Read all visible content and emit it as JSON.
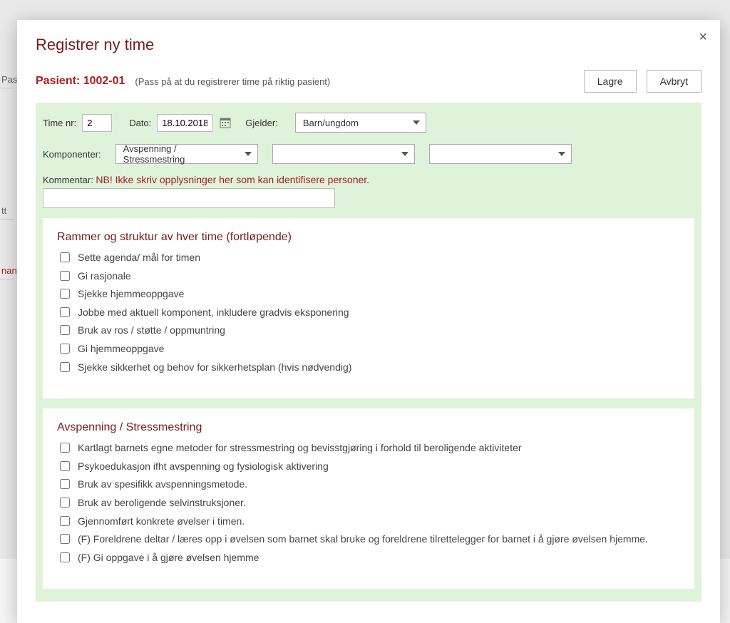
{
  "modal": {
    "title": "Registrer ny time",
    "close_label": "×"
  },
  "patient": {
    "label": "Pasient: 1002-01",
    "hint": "(Pass på at du registrerer time på riktig pasient)"
  },
  "actions": {
    "save": "Lagre",
    "cancel": "Avbryt"
  },
  "form": {
    "time_nr_label": "Time nr:",
    "time_nr_value": "2",
    "dato_label": "Dato:",
    "dato_value": "18.10.2018",
    "gjelder_label": "Gjelder:",
    "gjelder_value": "Barn/ungdom",
    "komponenter_label": "Komponenter:",
    "komponent1_value": "Avspenning / Stressmestring",
    "komponent2_value": "",
    "komponent3_value": "",
    "kommentar_label": "Kommentar: ",
    "kommentar_warn": "NB! Ikke skriv opplysninger her som kan identifisere personer.",
    "kommentar_value": ""
  },
  "section1": {
    "title": "Rammer og struktur av hver time (fortløpende)",
    "items": [
      "Sette agenda/ mål for timen",
      "Gi rasjonale",
      "Sjekke hjemmeoppgave",
      "Jobbe med aktuell komponent, inkludere gradvis eksponering",
      "Bruk av ros / støtte / oppmuntring",
      "Gi hjemmeoppgave",
      "Sjekke sikkerhet og behov for sikkerhetsplan (hvis nødvendig)"
    ]
  },
  "section2": {
    "title": "Avspenning / Stressmestring",
    "items": [
      "Kartlagt barnets egne metoder for stressmestring og bevisstgjøring i forhold til beroligende aktiviteter",
      "Psykoedukasjon ifht avspenning og fysiologisk aktivering",
      "Bruk av spesifikk avspenningsmetode.",
      "Bruk av beroligende selvinstruksjoner.",
      "Gjennomført konkrete øvelser i timen.",
      "(F) Foreldrene deltar / læres opp i øvelsen som barnet skal bruke og foreldrene tilrettelegger for barnet i å gjøre øvelsen hjemme.",
      "(F) Gi oppgave i å gjøre øvelsen hjemme"
    ]
  },
  "bg": {
    "a": "Pas",
    "b": "tt",
    "c": "nan"
  }
}
